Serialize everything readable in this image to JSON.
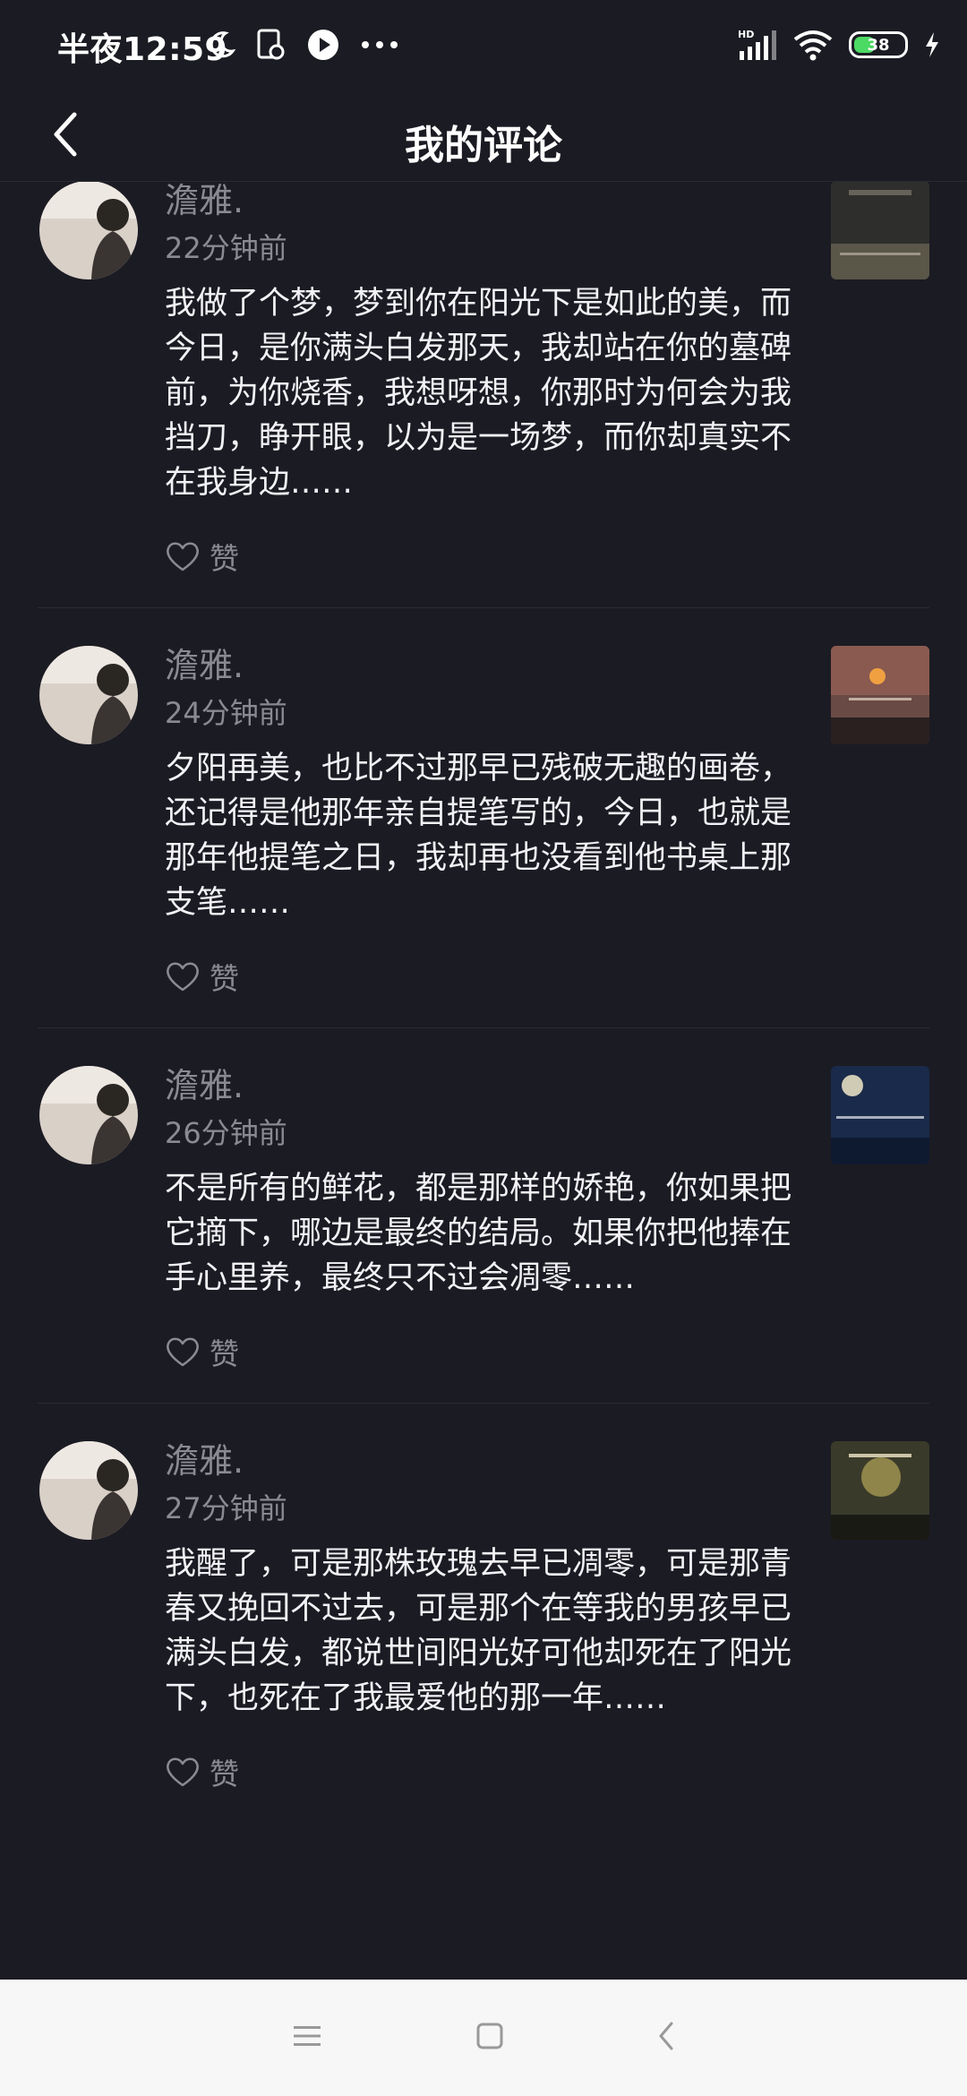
{
  "status_bar": {
    "time": "半夜12:59",
    "network": "HD",
    "battery": "38"
  },
  "header": {
    "title": "我的评论"
  },
  "comments": [
    {
      "user": "澹雅.",
      "time": "22分钟前",
      "text": "我做了个梦，梦到你在阳光下是如此的美，而今日，是你满头白发那天，我却站在你的墓碑前，为你烧香，我想呀想，你那时为何会为我挡刀，睁开眼，以为是一场梦，而你却真实不在我身边……",
      "like_label": "赞"
    },
    {
      "user": "澹雅.",
      "time": "24分钟前",
      "text": "夕阳再美，也比不过那早已残破无趣的画卷，还记得是他那年亲自提笔写的，今日，也就是那年他提笔之日，我却再也没看到他书桌上那支笔……",
      "like_label": "赞"
    },
    {
      "user": "澹雅.",
      "time": "26分钟前",
      "text": "不是所有的鲜花，都是那样的娇艳，你如果把它摘下，哪边是最终的结局。如果你把他捧在手心里养，最终只不过会凋零……",
      "like_label": "赞"
    },
    {
      "user": "澹雅.",
      "time": "27分钟前",
      "text": "我醒了，可是那株玫瑰去早已凋零，可是那青春又挽回不过去，可是那个在等我的男孩早已满头白发，都说世间阳光好可他却死在了阳光下，也死在了我最爱他的那一年……",
      "like_label": "赞"
    }
  ],
  "colors": {
    "background": "#1b1b23",
    "text_primary": "#f2f2f6",
    "text_secondary": "#8a8a92",
    "nav_bar": "#f7f7f7"
  }
}
